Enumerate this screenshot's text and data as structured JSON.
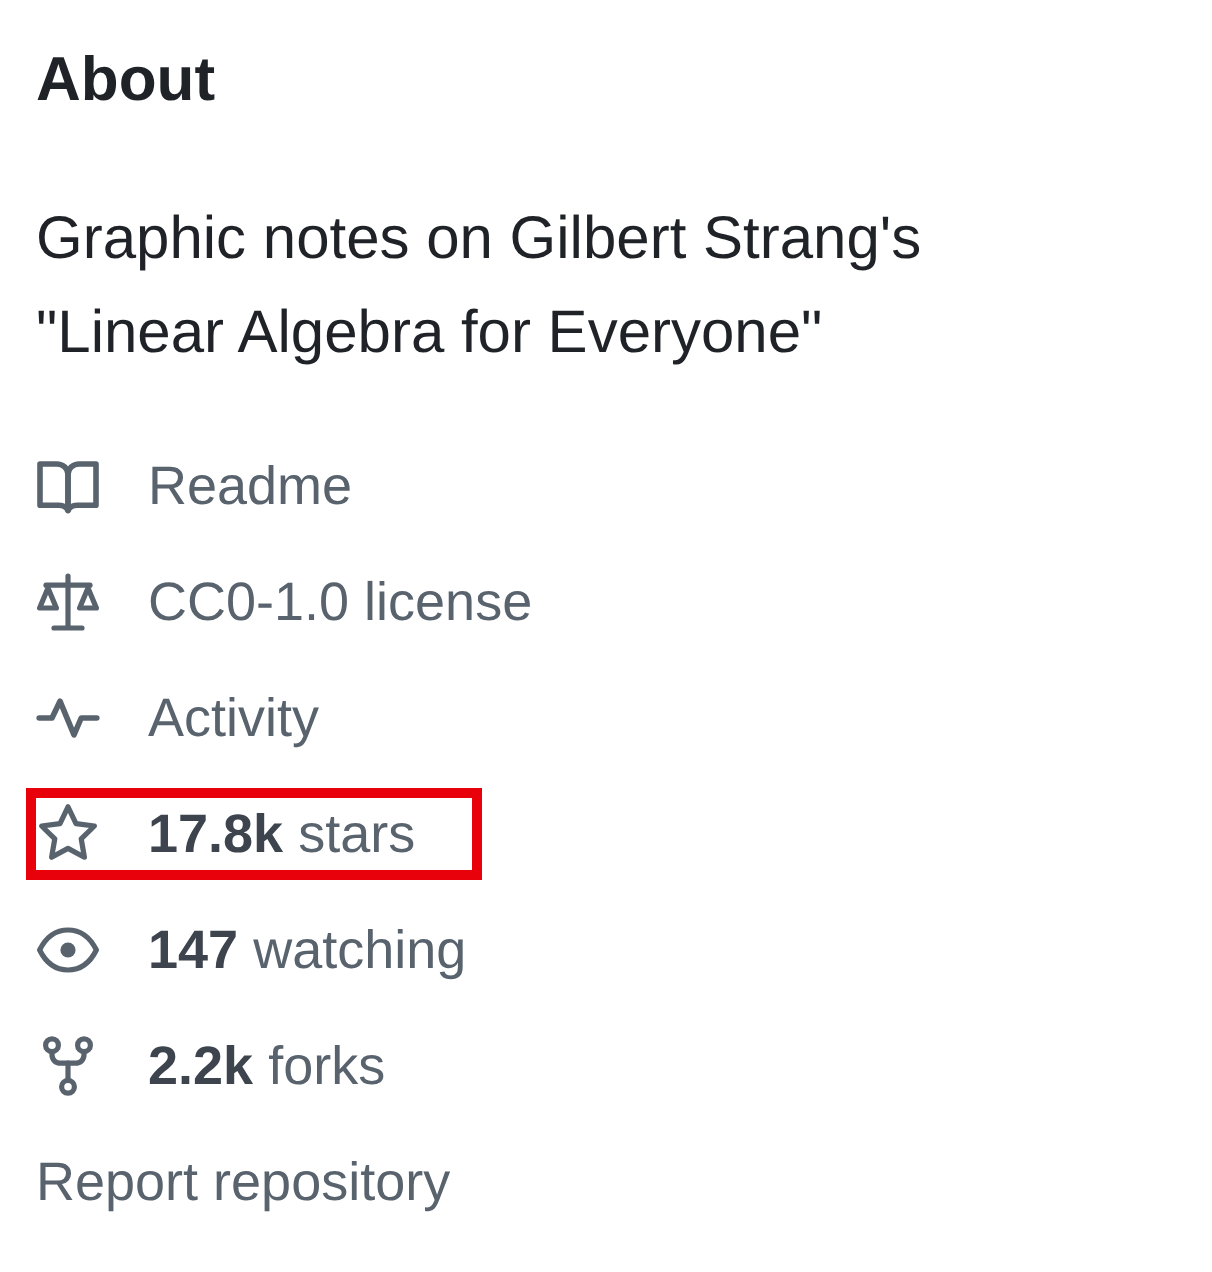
{
  "about": {
    "title": "About",
    "description": "Graphic notes on Gilbert Strang's \"Linear Algebra for Everyone\""
  },
  "links": [
    {
      "kind": "readme",
      "label": "Readme",
      "highlighted": false
    },
    {
      "kind": "license",
      "label": "CC0-1.0 license",
      "highlighted": false
    },
    {
      "kind": "activity",
      "label": "Activity",
      "highlighted": false
    },
    {
      "kind": "stars",
      "count": "17.8k",
      "label": "stars",
      "highlighted": true
    },
    {
      "kind": "watching",
      "count": "147",
      "label": "watching",
      "highlighted": false
    },
    {
      "kind": "forks",
      "count": "2.2k",
      "label": "forks",
      "highlighted": false
    }
  ],
  "report_link": {
    "label": "Report repository"
  }
}
